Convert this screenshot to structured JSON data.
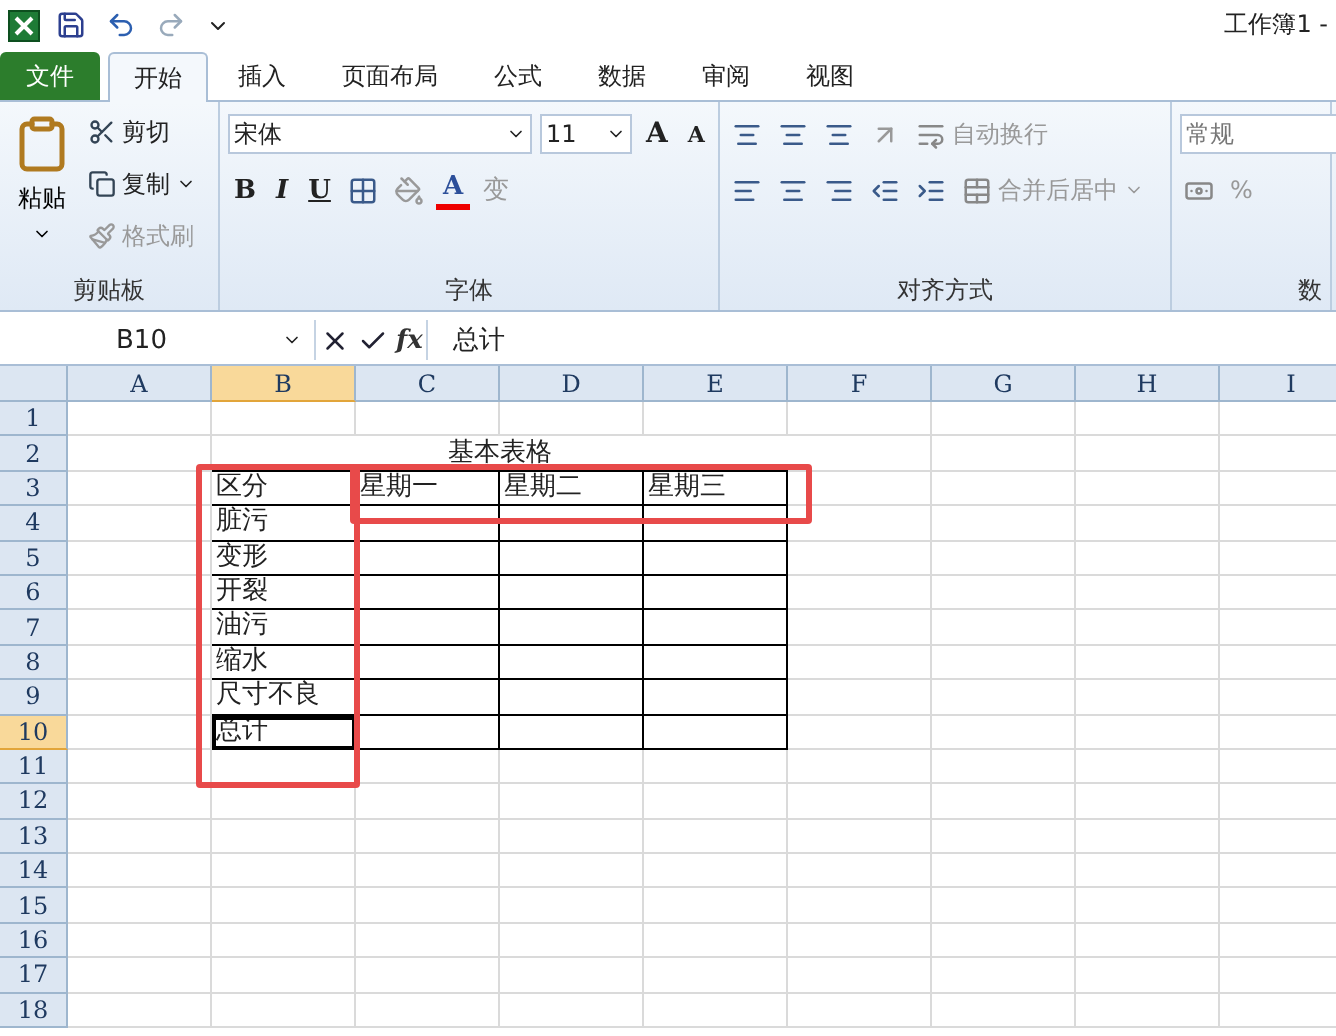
{
  "window": {
    "title": "工作簿1 -"
  },
  "tabs": [
    {
      "label": "文件",
      "kind": "file",
      "selected": false
    },
    {
      "label": "开始",
      "kind": "tab",
      "selected": true
    },
    {
      "label": "插入",
      "kind": "tab",
      "selected": false
    },
    {
      "label": "页面布局",
      "kind": "tab",
      "selected": false
    },
    {
      "label": "公式",
      "kind": "tab",
      "selected": false
    },
    {
      "label": "数据",
      "kind": "tab",
      "selected": false
    },
    {
      "label": "审阅",
      "kind": "tab",
      "selected": false
    },
    {
      "label": "视图",
      "kind": "tab",
      "selected": false
    }
  ],
  "clipboard": {
    "label": "剪贴板",
    "paste": "粘贴",
    "items": [
      {
        "label": "剪切",
        "disabled": false,
        "dropdown": false
      },
      {
        "label": "复制",
        "disabled": false,
        "dropdown": true
      },
      {
        "label": "格式刷",
        "disabled": true,
        "dropdown": false
      }
    ]
  },
  "font": {
    "label": "字体",
    "font_name": "宋体",
    "font_size": "11",
    "grow": "A",
    "shrink": "A",
    "bold": "B",
    "italic": "I",
    "underline": "U",
    "font_color": "A",
    "phonetic": "变"
  },
  "alignment": {
    "label": "对齐方式",
    "wrap": "自动换行",
    "merge": "合并后居中"
  },
  "number": {
    "label": "数",
    "format": "常规",
    "percent": "%"
  },
  "formula_bar": {
    "name_box": "B10",
    "fx": "fx",
    "value": "总计"
  },
  "columns": [
    {
      "label": "A",
      "selected": false
    },
    {
      "label": "B",
      "selected": true
    },
    {
      "label": "C",
      "selected": false
    },
    {
      "label": "D",
      "selected": false
    },
    {
      "label": "E",
      "selected": false
    },
    {
      "label": "F",
      "selected": false
    },
    {
      "label": "G",
      "selected": false
    },
    {
      "label": "H",
      "selected": false
    },
    {
      "label": "I",
      "selected": false
    }
  ],
  "rows": [
    {
      "label": "1",
      "selected": false
    },
    {
      "label": "2",
      "selected": false
    },
    {
      "label": "3",
      "selected": false
    },
    {
      "label": "4",
      "selected": false
    },
    {
      "label": "5",
      "selected": false
    },
    {
      "label": "6",
      "selected": false
    },
    {
      "label": "7",
      "selected": false
    },
    {
      "label": "8",
      "selected": false
    },
    {
      "label": "9",
      "selected": false
    },
    {
      "label": "10",
      "selected": true
    },
    {
      "label": "11",
      "selected": false
    },
    {
      "label": "12",
      "selected": false
    },
    {
      "label": "13",
      "selected": false
    },
    {
      "label": "14",
      "selected": false
    },
    {
      "label": "15",
      "selected": false
    },
    {
      "label": "16",
      "selected": false
    },
    {
      "label": "17",
      "selected": false
    },
    {
      "label": "18",
      "selected": false
    }
  ],
  "table": {
    "title": "基本表格",
    "header": [
      "区分",
      "星期一",
      "星期二",
      "星期三"
    ],
    "rows": [
      [
        "脏污",
        "",
        "",
        ""
      ],
      [
        "变形",
        "",
        "",
        ""
      ],
      [
        "开裂",
        "",
        "",
        ""
      ],
      [
        "油污",
        "",
        "",
        ""
      ],
      [
        "缩水",
        "",
        "",
        ""
      ],
      [
        "尺寸不良",
        "",
        "",
        ""
      ],
      [
        "总计",
        "",
        "",
        ""
      ]
    ]
  }
}
